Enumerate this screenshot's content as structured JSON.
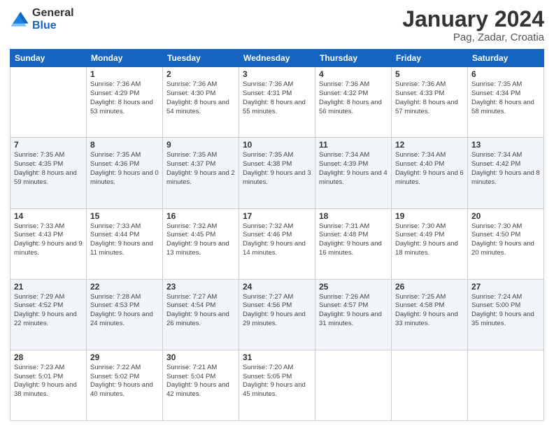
{
  "header": {
    "logo_line1": "General",
    "logo_line2": "Blue",
    "title": "January 2024",
    "subtitle": "Pag, Zadar, Croatia"
  },
  "calendar": {
    "days": [
      "Sunday",
      "Monday",
      "Tuesday",
      "Wednesday",
      "Thursday",
      "Friday",
      "Saturday"
    ],
    "weeks": [
      [
        {
          "date": "",
          "sunrise": "",
          "sunset": "",
          "daylight": ""
        },
        {
          "date": "1",
          "sunrise": "Sunrise: 7:36 AM",
          "sunset": "Sunset: 4:29 PM",
          "daylight": "Daylight: 8 hours and 53 minutes."
        },
        {
          "date": "2",
          "sunrise": "Sunrise: 7:36 AM",
          "sunset": "Sunset: 4:30 PM",
          "daylight": "Daylight: 8 hours and 54 minutes."
        },
        {
          "date": "3",
          "sunrise": "Sunrise: 7:36 AM",
          "sunset": "Sunset: 4:31 PM",
          "daylight": "Daylight: 8 hours and 55 minutes."
        },
        {
          "date": "4",
          "sunrise": "Sunrise: 7:36 AM",
          "sunset": "Sunset: 4:32 PM",
          "daylight": "Daylight: 8 hours and 56 minutes."
        },
        {
          "date": "5",
          "sunrise": "Sunrise: 7:36 AM",
          "sunset": "Sunset: 4:33 PM",
          "daylight": "Daylight: 8 hours and 57 minutes."
        },
        {
          "date": "6",
          "sunrise": "Sunrise: 7:35 AM",
          "sunset": "Sunset: 4:34 PM",
          "daylight": "Daylight: 8 hours and 58 minutes."
        }
      ],
      [
        {
          "date": "7",
          "sunrise": "Sunrise: 7:35 AM",
          "sunset": "Sunset: 4:35 PM",
          "daylight": "Daylight: 8 hours and 59 minutes."
        },
        {
          "date": "8",
          "sunrise": "Sunrise: 7:35 AM",
          "sunset": "Sunset: 4:36 PM",
          "daylight": "Daylight: 9 hours and 0 minutes."
        },
        {
          "date": "9",
          "sunrise": "Sunrise: 7:35 AM",
          "sunset": "Sunset: 4:37 PM",
          "daylight": "Daylight: 9 hours and 2 minutes."
        },
        {
          "date": "10",
          "sunrise": "Sunrise: 7:35 AM",
          "sunset": "Sunset: 4:38 PM",
          "daylight": "Daylight: 9 hours and 3 minutes."
        },
        {
          "date": "11",
          "sunrise": "Sunrise: 7:34 AM",
          "sunset": "Sunset: 4:39 PM",
          "daylight": "Daylight: 9 hours and 4 minutes."
        },
        {
          "date": "12",
          "sunrise": "Sunrise: 7:34 AM",
          "sunset": "Sunset: 4:40 PM",
          "daylight": "Daylight: 9 hours and 6 minutes."
        },
        {
          "date": "13",
          "sunrise": "Sunrise: 7:34 AM",
          "sunset": "Sunset: 4:42 PM",
          "daylight": "Daylight: 9 hours and 8 minutes."
        }
      ],
      [
        {
          "date": "14",
          "sunrise": "Sunrise: 7:33 AM",
          "sunset": "Sunset: 4:43 PM",
          "daylight": "Daylight: 9 hours and 9 minutes."
        },
        {
          "date": "15",
          "sunrise": "Sunrise: 7:33 AM",
          "sunset": "Sunset: 4:44 PM",
          "daylight": "Daylight: 9 hours and 11 minutes."
        },
        {
          "date": "16",
          "sunrise": "Sunrise: 7:32 AM",
          "sunset": "Sunset: 4:45 PM",
          "daylight": "Daylight: 9 hours and 13 minutes."
        },
        {
          "date": "17",
          "sunrise": "Sunrise: 7:32 AM",
          "sunset": "Sunset: 4:46 PM",
          "daylight": "Daylight: 9 hours and 14 minutes."
        },
        {
          "date": "18",
          "sunrise": "Sunrise: 7:31 AM",
          "sunset": "Sunset: 4:48 PM",
          "daylight": "Daylight: 9 hours and 16 minutes."
        },
        {
          "date": "19",
          "sunrise": "Sunrise: 7:30 AM",
          "sunset": "Sunset: 4:49 PM",
          "daylight": "Daylight: 9 hours and 18 minutes."
        },
        {
          "date": "20",
          "sunrise": "Sunrise: 7:30 AM",
          "sunset": "Sunset: 4:50 PM",
          "daylight": "Daylight: 9 hours and 20 minutes."
        }
      ],
      [
        {
          "date": "21",
          "sunrise": "Sunrise: 7:29 AM",
          "sunset": "Sunset: 4:52 PM",
          "daylight": "Daylight: 9 hours and 22 minutes."
        },
        {
          "date": "22",
          "sunrise": "Sunrise: 7:28 AM",
          "sunset": "Sunset: 4:53 PM",
          "daylight": "Daylight: 9 hours and 24 minutes."
        },
        {
          "date": "23",
          "sunrise": "Sunrise: 7:27 AM",
          "sunset": "Sunset: 4:54 PM",
          "daylight": "Daylight: 9 hours and 26 minutes."
        },
        {
          "date": "24",
          "sunrise": "Sunrise: 7:27 AM",
          "sunset": "Sunset: 4:56 PM",
          "daylight": "Daylight: 9 hours and 29 minutes."
        },
        {
          "date": "25",
          "sunrise": "Sunrise: 7:26 AM",
          "sunset": "Sunset: 4:57 PM",
          "daylight": "Daylight: 9 hours and 31 minutes."
        },
        {
          "date": "26",
          "sunrise": "Sunrise: 7:25 AM",
          "sunset": "Sunset: 4:58 PM",
          "daylight": "Daylight: 9 hours and 33 minutes."
        },
        {
          "date": "27",
          "sunrise": "Sunrise: 7:24 AM",
          "sunset": "Sunset: 5:00 PM",
          "daylight": "Daylight: 9 hours and 35 minutes."
        }
      ],
      [
        {
          "date": "28",
          "sunrise": "Sunrise: 7:23 AM",
          "sunset": "Sunset: 5:01 PM",
          "daylight": "Daylight: 9 hours and 38 minutes."
        },
        {
          "date": "29",
          "sunrise": "Sunrise: 7:22 AM",
          "sunset": "Sunset: 5:02 PM",
          "daylight": "Daylight: 9 hours and 40 minutes."
        },
        {
          "date": "30",
          "sunrise": "Sunrise: 7:21 AM",
          "sunset": "Sunset: 5:04 PM",
          "daylight": "Daylight: 9 hours and 42 minutes."
        },
        {
          "date": "31",
          "sunrise": "Sunrise: 7:20 AM",
          "sunset": "Sunset: 5:05 PM",
          "daylight": "Daylight: 9 hours and 45 minutes."
        },
        {
          "date": "",
          "sunrise": "",
          "sunset": "",
          "daylight": ""
        },
        {
          "date": "",
          "sunrise": "",
          "sunset": "",
          "daylight": ""
        },
        {
          "date": "",
          "sunrise": "",
          "sunset": "",
          "daylight": ""
        }
      ]
    ]
  }
}
